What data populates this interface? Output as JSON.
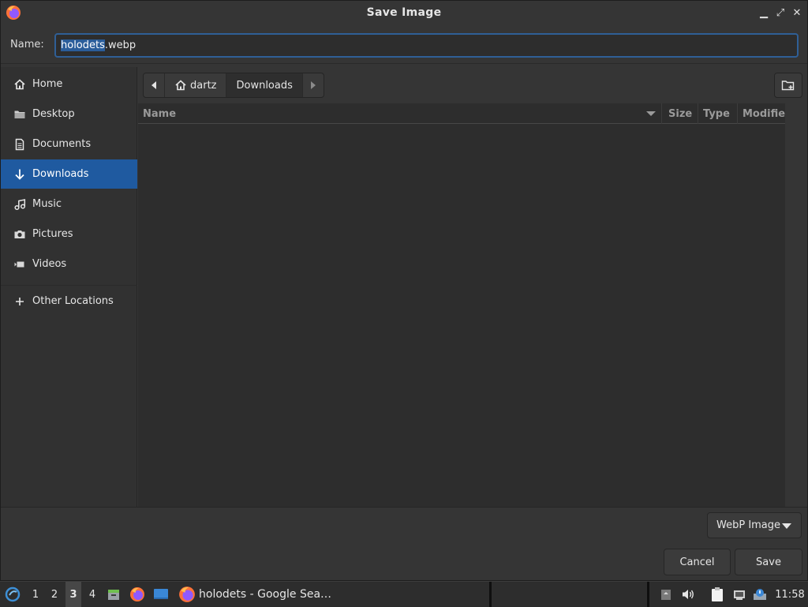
{
  "window": {
    "title": "Save Image",
    "controls": {
      "minimize": "▁",
      "maximize": "⤢",
      "close": "✕"
    }
  },
  "name_field": {
    "label": "Name:",
    "value_selected": "holodets",
    "value_rest": ".webp"
  },
  "sidebar": {
    "items": [
      {
        "label": "Home",
        "icon": "home-icon"
      },
      {
        "label": "Desktop",
        "icon": "folder-icon"
      },
      {
        "label": "Documents",
        "icon": "document-icon"
      },
      {
        "label": "Downloads",
        "icon": "download-icon",
        "active": true
      },
      {
        "label": "Music",
        "icon": "music-icon"
      },
      {
        "label": "Pictures",
        "icon": "camera-icon"
      },
      {
        "label": "Videos",
        "icon": "video-icon"
      }
    ],
    "other": {
      "label": "Other Locations",
      "icon": "plus-icon"
    }
  },
  "pathbar": {
    "segments": [
      "dartz",
      "Downloads"
    ]
  },
  "file_list": {
    "columns": [
      "Name",
      "Size",
      "Type",
      "Modifie"
    ]
  },
  "file_type": {
    "selected": "WebP Image"
  },
  "buttons": {
    "cancel": "Cancel",
    "save": "Save"
  },
  "taskbar": {
    "workspaces": [
      "1",
      "2",
      "3",
      "4"
    ],
    "active_workspace": "3",
    "window_title": "holodets - Google Sea…",
    "clock": "11:58"
  },
  "colors": {
    "accent": "#1f5aa0",
    "selection": "#2a5d9a",
    "background": "#353535",
    "list_background": "#2d2d2d"
  }
}
